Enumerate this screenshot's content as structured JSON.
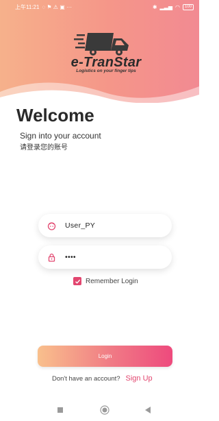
{
  "status_bar": {
    "time": "上午11:21",
    "battery": "100"
  },
  "brand": {
    "name": "e-TranStar",
    "tagline": "Logistics on your finger tips"
  },
  "welcome": {
    "title": "Welcome",
    "subtitle": "Sign into your account",
    "subtitle_cn": "请登录您的账号"
  },
  "form": {
    "username_value": "User_PY",
    "password_value": "••••",
    "remember_label": "Remember Login",
    "remember_checked": true,
    "login_label": "Login"
  },
  "footer": {
    "no_account_text": "Don't have an account?",
    "signup_label": "Sign Up"
  },
  "icons": {
    "username": "user-face-icon",
    "password": "lock-icon",
    "checkbox": "check-icon"
  },
  "colors": {
    "accent": "#e2466f",
    "header_gradient_start": "#f6b18b",
    "header_gradient_end": "#f28a92"
  }
}
